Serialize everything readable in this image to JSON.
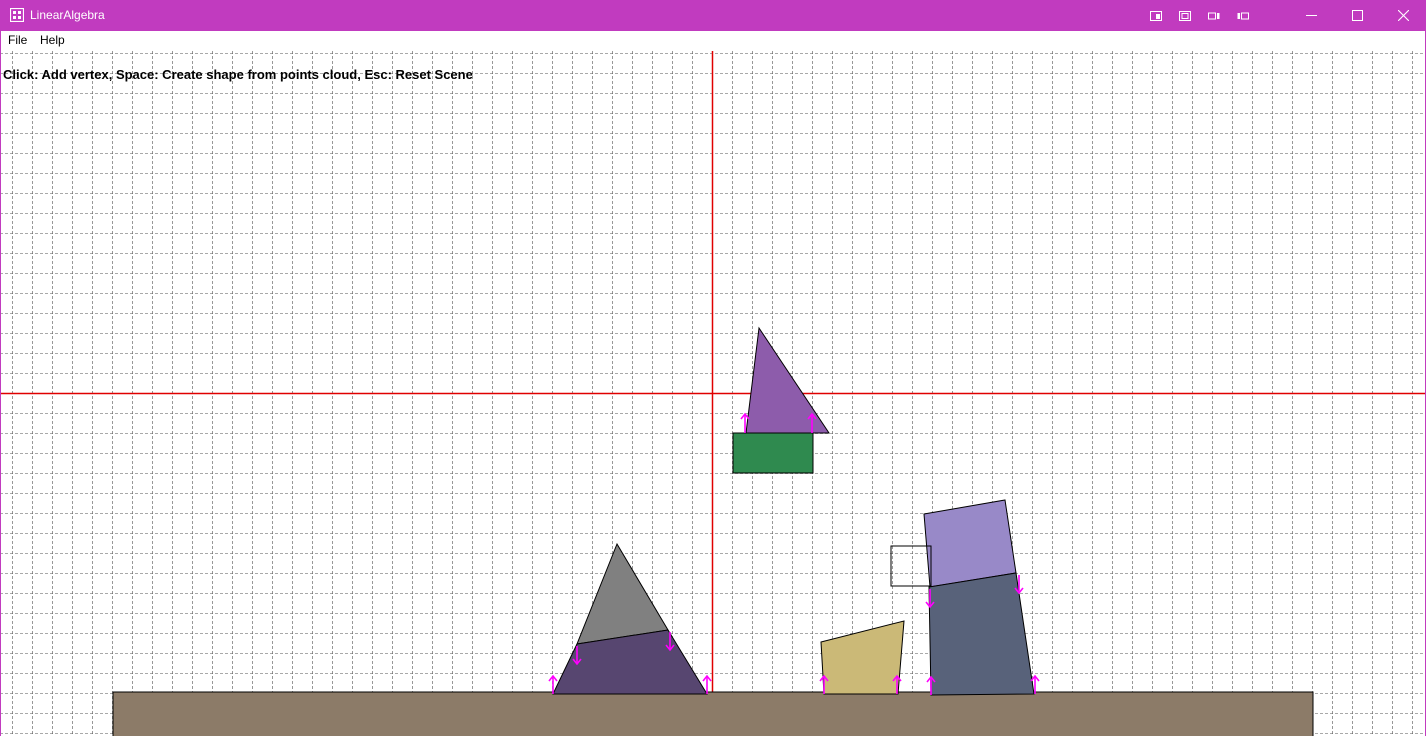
{
  "window": {
    "title": "LinearAlgebra",
    "titlebar_color": "#c13bbf",
    "icons": {
      "app": "window-grid-icon",
      "extra_buttons": [
        "snap-layout-icon",
        "fullscreen-icon",
        "tile-left-icon",
        "tile-right-icon"
      ],
      "minimize": "minimize-icon",
      "maximize": "maximize-icon",
      "close": "close-icon"
    }
  },
  "menu": {
    "items": [
      "File",
      "Help"
    ]
  },
  "scene": {
    "hint": "Click: Add vertex, Space: Create shape from points cloud, Esc: Reset Scene",
    "grid": "dashed",
    "axis_color": "#e00000",
    "shape_colors": {
      "ground": "#8c7b68",
      "gray_triangle": "#808080",
      "dark_purple_trapezoid": "#574670",
      "purple_triangle": "#8d5cab",
      "green_rectangle": "#2f8a4f",
      "tan_quad": "#cbb977",
      "light_purple_quad": "#9889c8",
      "slate_quad": "#58627a",
      "outline_rect": "none"
    },
    "arrow_color": "#ff00ff"
  }
}
